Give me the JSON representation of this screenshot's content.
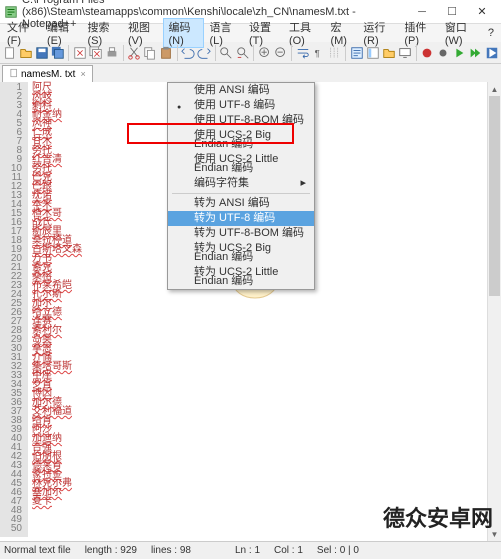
{
  "title": "C:\\Program Files (x86)\\Steam\\steamapps\\common\\Kenshi\\locale\\zh_CN\\namesM.txt - Notepad++",
  "menu": {
    "file": "文件(F)",
    "edit": "编辑(E)",
    "search": "搜索(S)",
    "view": "视图(V)",
    "encoding": "编码(N)",
    "language": "语言(L)",
    "settings": "设置(T)",
    "tools": "工具(O)",
    "macro": "宏(M)",
    "run": "运行(R)",
    "plugins": "插件(P)",
    "window": "窗口(W)",
    "help": "?"
  },
  "dropdown": {
    "i0": "使用 ANSI 编码",
    "i1": "使用 UTF-8 编码",
    "i2": "使用 UTF-8-BOM 编码",
    "i3": "使用 UCS-2 Big Endian 编码",
    "i4": "使用 UCS-2 Little Endian 编码",
    "i5": "编码字符集",
    "i6": "转为 ANSI 编码",
    "i7": "转为 UTF-8 编码",
    "i8": "转为 UTF-8-BOM 编码",
    "i9": "转为 UCS-2 Big Endian 编码",
    "i10": "转为 UCS-2 Little Endian 编码"
  },
  "tab": {
    "name": "namesM. txt",
    "close": "×"
  },
  "lines": [
    "阿尺",
    "风岐",
    "剿料",
    "耐金纳",
    "风神",
    "仁成",
    "甘木",
    "努托",
    "红告清",
    "努托",
    "巴克",
    "巴跟",
    "疣诺",
    "本来",
    "楂木哥",
    "战氏",
    "斯辰里",
    "莫拉楟道",
    "古斯塔文森",
    "万书",
    "素克",
    "桑榕",
    "布莱希皑",
    "扎尔斯",
    "加尔",
    "哈立德",
    "逢赛",
    "素利尔",
    "岛奥",
    "拿恩",
    "介慲",
    "集塔哥斯",
    "甲座",
    "罗肯",
    "博因",
    "加尔德",
    "艾利福道",
    "哈肯",
    "阿沙",
    "加迪纳",
    "吉强",
    "伯朋根",
    "德莱肯",
    "蒙特金",
    "林克尔弗",
    "塞加尔",
    "夏卡"
  ],
  "status": {
    "type": "Normal text file",
    "length": "length : 929",
    "lines": "lines : 98",
    "ln": "Ln : 1",
    "col": "Col : 1",
    "sel": "Sel : 0 | 0"
  },
  "watermark": "德众安卓网"
}
